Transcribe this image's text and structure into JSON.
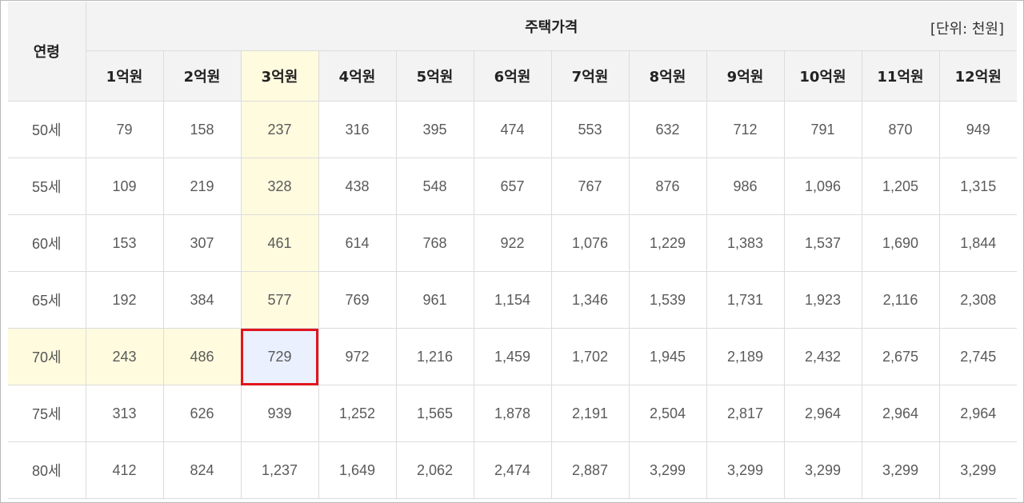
{
  "table": {
    "age_header": "연령",
    "price_header": "주택가격",
    "unit": "[단위: 천원]",
    "columns": [
      "1억원",
      "2억원",
      "3억원",
      "4억원",
      "5억원",
      "6억원",
      "7억원",
      "8억원",
      "9억원",
      "10억원",
      "11억원",
      "12억원"
    ],
    "rows": [
      {
        "age": "50세",
        "values": [
          "79",
          "158",
          "237",
          "316",
          "395",
          "474",
          "553",
          "632",
          "712",
          "791",
          "870",
          "949"
        ]
      },
      {
        "age": "55세",
        "values": [
          "109",
          "219",
          "328",
          "438",
          "548",
          "657",
          "767",
          "876",
          "986",
          "1,096",
          "1,205",
          "1,315"
        ]
      },
      {
        "age": "60세",
        "values": [
          "153",
          "307",
          "461",
          "614",
          "768",
          "922",
          "1,076",
          "1,229",
          "1,383",
          "1,537",
          "1,690",
          "1,844"
        ]
      },
      {
        "age": "65세",
        "values": [
          "192",
          "384",
          "577",
          "769",
          "961",
          "1,154",
          "1,346",
          "1,539",
          "1,731",
          "1,923",
          "2,116",
          "2,308"
        ]
      },
      {
        "age": "70세",
        "values": [
          "243",
          "486",
          "729",
          "972",
          "1,216",
          "1,459",
          "1,702",
          "1,945",
          "2,189",
          "2,432",
          "2,675",
          "2,745"
        ]
      },
      {
        "age": "75세",
        "values": [
          "313",
          "626",
          "939",
          "1,252",
          "1,565",
          "1,878",
          "2,191",
          "2,504",
          "2,817",
          "2,964",
          "2,964",
          "2,964"
        ]
      },
      {
        "age": "80세",
        "values": [
          "412",
          "824",
          "1,237",
          "1,649",
          "2,062",
          "2,474",
          "2,887",
          "3,299",
          "3,299",
          "3,299",
          "3,299",
          "3,299"
        ]
      }
    ],
    "highlight_color": "#fffbdf",
    "selected_color": "#eaf0fd",
    "selected_border_color": "#e0151e"
  }
}
